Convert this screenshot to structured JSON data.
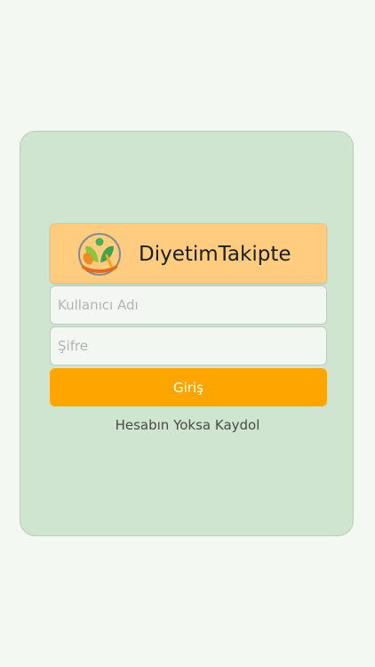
{
  "brand": {
    "title": "DiyetimTakipte",
    "logo_icon": "healthy-food-logo-icon"
  },
  "form": {
    "username_placeholder": "Kullanıcı Adı",
    "password_placeholder": "Şifre",
    "login_label": "Giriş",
    "signup_label": "Hesabın Yoksa Kaydol"
  },
  "colors": {
    "page_background": "#f3f9f2",
    "card_background": "#cfe5cf",
    "brand_background": "#ffcc80",
    "button_accent": "#ffa500"
  }
}
